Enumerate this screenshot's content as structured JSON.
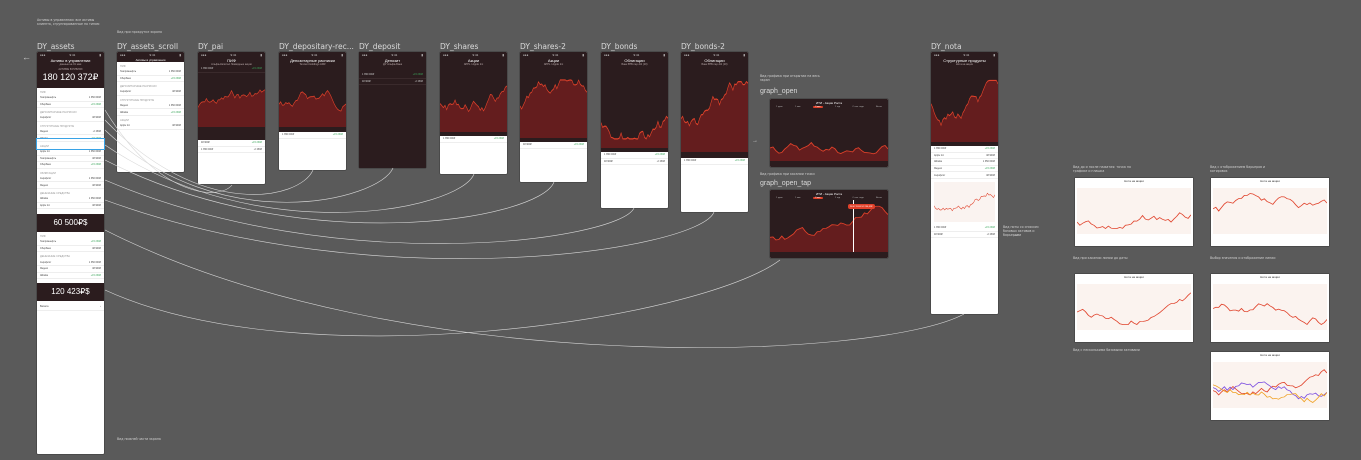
{
  "frames": {
    "assets": "DY_assets",
    "assets_scroll": "DY_assets_scroll",
    "pai": "DY_pai",
    "depositary": "DY_depositary-rec...",
    "deposit": "DY_deposit",
    "shares": "DY_shares",
    "shares2": "DY_shares-2",
    "bonds": "DY_bonds",
    "bonds2": "DY_bonds-2",
    "nota": "DY_nota",
    "graph_open": "graph_open",
    "graph_open_tap": "graph_open_tap"
  },
  "assets_screen": {
    "title": "Активы в управлении",
    "subtitle": "данные на 01 мая",
    "caption": "АКТИВЫ В РУБЛЯХ",
    "total_rub": "180 120 372₽",
    "total_usd": "60 500₽$",
    "total_usd2": "120 423₽$",
    "sections": [
      "ПИФ",
      "ДЕПОЗИТАРНЫЕ РАСПИСКИ",
      "СТРУКТУРНЫЕ ПРОДУКТЫ",
      "АКЦИИ",
      "ОБЛИГАЦИИ",
      "ДЕНЕЖНЫЕ СРЕДСТВА"
    ],
    "items": [
      "Газпромнефть",
      "Сбербанк",
      "Аэрофлот",
      "Яндекс",
      "Alibaba",
      "Apple Inc"
    ],
    "values": [
      "1 350 000₽",
      "+15 230₽",
      "48 900₽",
      "-2 150₽"
    ],
    "footer_item": "Валюта"
  },
  "detail_titles": {
    "pai": "ПИФ",
    "depositary": "Депозитарные расписки",
    "deposit": "Депозит",
    "shares": "Акции",
    "shares2": "Акции",
    "bonds": "Облигации",
    "bonds2": "Облигации",
    "nota": "Структурные продукты"
  },
  "detail_subtitles": {
    "pai": "Альфа-Капитал Ликвидные акции",
    "depositary": "Tencent Holdings ADR",
    "deposit": "ДУ Альфа-Банк",
    "shares": "APPL / Apple Inc",
    "bonds": "Банк ВТБ пер.4/2 (10)",
    "nota": "Нота на акции"
  },
  "tabs": [
    "1 день",
    "1 мес",
    "3 мес",
    "1 год",
    "С нач. года",
    "Всего"
  ],
  "graph": {
    "title": "ИТИ - Акции Роста",
    "tooltip_value": "28.07.2018 52 234,42₽"
  },
  "nota_panel": {
    "title": "Нота на акции",
    "notes": [
      "Вид до и после нажатия: точка на графике и плашка",
      "Вид с отображением барьеров и котировок",
      "Вид при касании линии до даты",
      "Выбор значения и отображение линии",
      "Вид с несколькими базовыми активами"
    ]
  },
  "notes": {
    "top_left": "Активы в управлении: все активы клиента, сгруппированные по типам",
    "scroll": "Вид при прокрутке экрана",
    "graph": "Вид графика при открытии на весь экран",
    "graph_tap": "Вид графика при касании точки",
    "bottom": "Вид нижней части экрана",
    "nota_right": "Вид ноты со списком базовых активов и барьерами"
  },
  "colors": {
    "canvas": "#5a5a5a",
    "header": "#2b1c1e",
    "accent": "#e0412a",
    "positive": "#3aa55a",
    "selection": "#39a3e6"
  }
}
